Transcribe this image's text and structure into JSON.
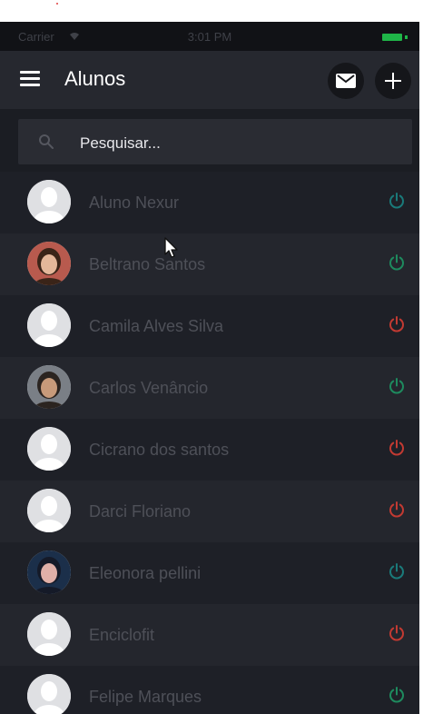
{
  "status_bar": {
    "carrier": "Carrier",
    "time": "3:01 PM"
  },
  "header": {
    "title": "Alunos",
    "mail_icon": "mail-icon",
    "add_icon": "plus-icon",
    "menu_icon": "hamburger-menu-icon"
  },
  "search": {
    "placeholder": "Pesquisar...",
    "value": ""
  },
  "colors": {
    "active": "#1e8a5e",
    "inactive": "#c23a32",
    "teal": "#1a7a7a",
    "background": "#1e2027"
  },
  "students": [
    {
      "name": "Aluno Nexur",
      "avatar": "placeholder",
      "status": "active"
    },
    {
      "name": "Beltrano Santos",
      "avatar": "photo",
      "status": "active"
    },
    {
      "name": "Camila Alves Silva",
      "avatar": "placeholder",
      "status": "inactive"
    },
    {
      "name": "Carlos Venâncio",
      "avatar": "photo",
      "status": "active"
    },
    {
      "name": "Cicrano dos santos",
      "avatar": "placeholder",
      "status": "inactive"
    },
    {
      "name": "Darci Floriano",
      "avatar": "placeholder",
      "status": "inactive"
    },
    {
      "name": "Eleonora pellini",
      "avatar": "photo",
      "status": "active"
    },
    {
      "name": "Enciclofit",
      "avatar": "placeholder",
      "status": "inactive"
    },
    {
      "name": "Felipe Marques",
      "avatar": "placeholder",
      "status": "active"
    }
  ]
}
